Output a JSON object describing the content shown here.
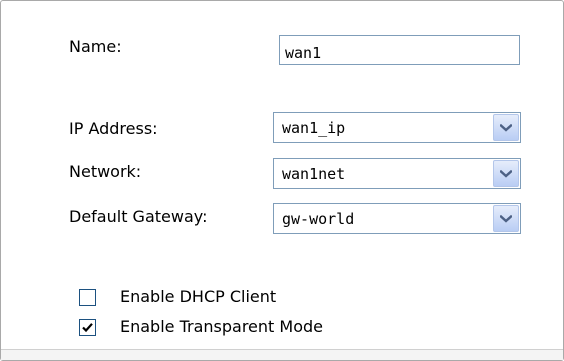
{
  "form": {
    "name": {
      "label": "Name:",
      "value": "wan1"
    },
    "ip_address": {
      "label": "IP Address:",
      "selected": "wan1_ip"
    },
    "network": {
      "label": "Network:",
      "selected": "wan1net"
    },
    "default_gateway": {
      "label": "Default Gateway:",
      "selected": "gw-world"
    },
    "dhcp_client": {
      "label": "Enable DHCP Client",
      "checked": false
    },
    "transparent_mode": {
      "label": "Enable Transparent Mode",
      "checked": true
    }
  },
  "icons": {
    "dropdown_arrow": "chevron-down-icon",
    "checkmark": "checkmark-icon"
  },
  "colors": {
    "field_border": "#7f9db9",
    "arrow_button": "#c4d5f8",
    "arrow_glyph": "#4d6185",
    "checkbox_border": "#1c5180"
  }
}
